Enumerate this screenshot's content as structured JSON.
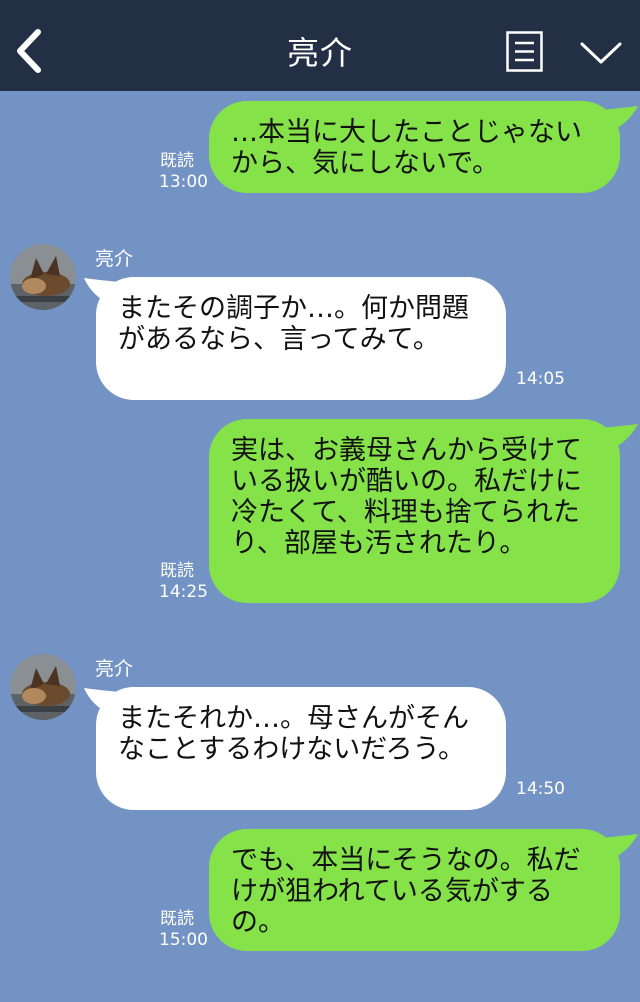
{
  "header": {
    "title": "亮介"
  },
  "messages": [
    {
      "from": "me",
      "text": "…本当に大したことじゃないから、気にしないで。",
      "read": "既読",
      "time": "13:00"
    },
    {
      "from": "them",
      "sender": "亮介",
      "text": "またその調子か…。何か問題があるなら、言ってみて。",
      "time": "14:05"
    },
    {
      "from": "me",
      "text": "実は、お義母さんから受けている扱いが酷いの。私だけに冷たくて、料理も捨てられたり、部屋も汚されたり。",
      "read": "既読",
      "time": "14:25"
    },
    {
      "from": "them",
      "sender": "亮介",
      "text": "またそれか…。母さんがそんなことするわけないだろう。",
      "time": "14:50"
    },
    {
      "from": "me",
      "text": "でも、本当にそうなの。私だけが狙われている気がするの。",
      "read": "既読",
      "time": "15:00"
    }
  ],
  "colors": {
    "header_bg": "#232f45",
    "chat_bg": "#7293c4",
    "my_bubble": "#85e249",
    "their_bubble": "#ffffff"
  }
}
